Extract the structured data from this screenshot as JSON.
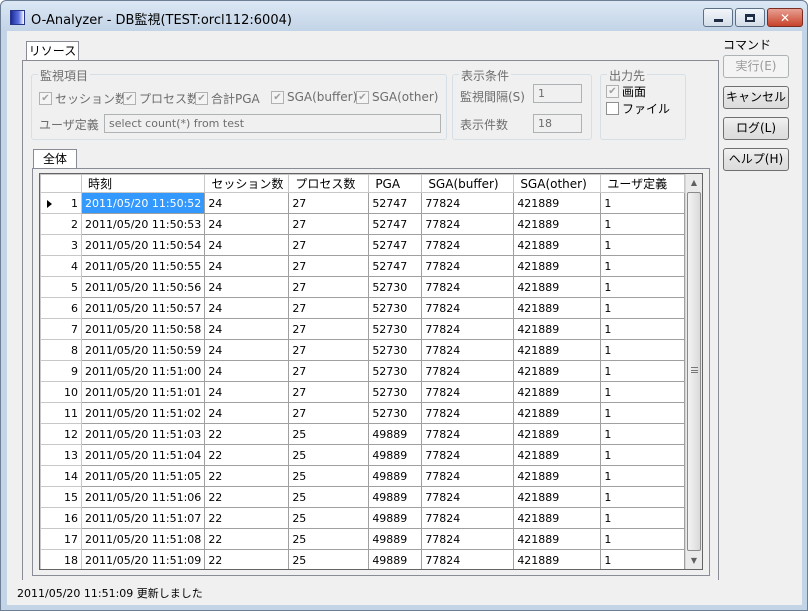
{
  "window": {
    "title": "O-Analyzer - DB監視(TEST:orcl112:6004)"
  },
  "tabs": {
    "resource": "リソース",
    "all": "全体"
  },
  "monitor": {
    "label": "監視項目",
    "items": [
      {
        "label": "セッション数",
        "checked": true
      },
      {
        "label": "プロセス数",
        "checked": true
      },
      {
        "label": "合計PGA",
        "checked": true
      },
      {
        "label": "SGA(buffer)",
        "checked": true
      },
      {
        "label": "SGA(other)",
        "checked": true
      }
    ],
    "user_def_label": "ユーザ定義",
    "user_def_value": "select count(*) from test"
  },
  "display": {
    "label": "表示条件",
    "interval_label": "監視間隔(S)",
    "interval_value": "1",
    "count_label": "表示件数",
    "count_value": "18"
  },
  "output": {
    "label": "出力先",
    "screen": {
      "label": "画面",
      "checked": true
    },
    "file": {
      "label": "ファイル",
      "checked": false
    }
  },
  "commands": {
    "label": "コマンド",
    "run": "実行(E)",
    "cancel": "キャンセル",
    "log": "ログ(L)",
    "help": "ヘルプ(H)"
  },
  "grid": {
    "columns": [
      "時刻",
      "セッション数",
      "プロセス数",
      "PGA",
      "SGA(buffer)",
      "SGA(other)",
      "ユーザ定義"
    ],
    "rows": [
      {
        "n": "1",
        "cells": [
          "2011/05/20 11:50:52",
          "24",
          "27",
          "52747",
          "77824",
          "421889",
          "1"
        ]
      },
      {
        "n": "2",
        "cells": [
          "2011/05/20 11:50:53",
          "24",
          "27",
          "52747",
          "77824",
          "421889",
          "1"
        ]
      },
      {
        "n": "3",
        "cells": [
          "2011/05/20 11:50:54",
          "24",
          "27",
          "52747",
          "77824",
          "421889",
          "1"
        ]
      },
      {
        "n": "4",
        "cells": [
          "2011/05/20 11:50:55",
          "24",
          "27",
          "52747",
          "77824",
          "421889",
          "1"
        ]
      },
      {
        "n": "5",
        "cells": [
          "2011/05/20 11:50:56",
          "24",
          "27",
          "52730",
          "77824",
          "421889",
          "1"
        ]
      },
      {
        "n": "6",
        "cells": [
          "2011/05/20 11:50:57",
          "24",
          "27",
          "52730",
          "77824",
          "421889",
          "1"
        ]
      },
      {
        "n": "7",
        "cells": [
          "2011/05/20 11:50:58",
          "24",
          "27",
          "52730",
          "77824",
          "421889",
          "1"
        ]
      },
      {
        "n": "8",
        "cells": [
          "2011/05/20 11:50:59",
          "24",
          "27",
          "52730",
          "77824",
          "421889",
          "1"
        ]
      },
      {
        "n": "9",
        "cells": [
          "2011/05/20 11:51:00",
          "24",
          "27",
          "52730",
          "77824",
          "421889",
          "1"
        ]
      },
      {
        "n": "10",
        "cells": [
          "2011/05/20 11:51:01",
          "24",
          "27",
          "52730",
          "77824",
          "421889",
          "1"
        ]
      },
      {
        "n": "11",
        "cells": [
          "2011/05/20 11:51:02",
          "24",
          "27",
          "52730",
          "77824",
          "421889",
          "1"
        ]
      },
      {
        "n": "12",
        "cells": [
          "2011/05/20 11:51:03",
          "22",
          "25",
          "49889",
          "77824",
          "421889",
          "1"
        ]
      },
      {
        "n": "13",
        "cells": [
          "2011/05/20 11:51:04",
          "22",
          "25",
          "49889",
          "77824",
          "421889",
          "1"
        ]
      },
      {
        "n": "14",
        "cells": [
          "2011/05/20 11:51:05",
          "22",
          "25",
          "49889",
          "77824",
          "421889",
          "1"
        ]
      },
      {
        "n": "15",
        "cells": [
          "2011/05/20 11:51:06",
          "22",
          "25",
          "49889",
          "77824",
          "421889",
          "1"
        ]
      },
      {
        "n": "16",
        "cells": [
          "2011/05/20 11:51:07",
          "22",
          "25",
          "49889",
          "77824",
          "421889",
          "1"
        ]
      },
      {
        "n": "17",
        "cells": [
          "2011/05/20 11:51:08",
          "22",
          "25",
          "49889",
          "77824",
          "421889",
          "1"
        ]
      },
      {
        "n": "18",
        "cells": [
          "2011/05/20 11:51:09",
          "22",
          "25",
          "49889",
          "77824",
          "421889",
          "1"
        ]
      }
    ]
  },
  "status": {
    "text": "2011/05/20 11:51:09 更新しました"
  }
}
